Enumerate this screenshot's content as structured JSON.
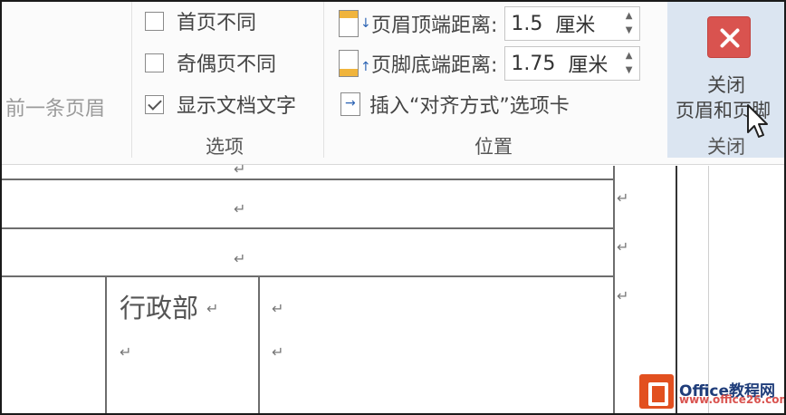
{
  "ribbon": {
    "navigation": {
      "prev_header_label": "前一条页眉"
    },
    "options": {
      "group_label": "选项",
      "items": [
        {
          "label": "首页不同",
          "checked": false
        },
        {
          "label": "奇偶页不同",
          "checked": false
        },
        {
          "label": "显示文档文字",
          "checked": true
        }
      ]
    },
    "position": {
      "group_label": "位置",
      "header_distance": {
        "label": "页眉顶端距离:",
        "value": "1.5",
        "unit": "厘米"
      },
      "footer_distance": {
        "label": "页脚底端距离:",
        "value": "1.75",
        "unit": "厘米"
      },
      "insert_align_tab_label": "插入“对齐方式”选项卡"
    },
    "close": {
      "group_label": "关闭",
      "button_line1": "关闭",
      "button_line2": "页眉和页脚"
    }
  },
  "document": {
    "paragraph_mark": "↵",
    "cell_text": "行政部"
  },
  "watermark": {
    "brand": "Office教程网",
    "url": "www.office26.com"
  },
  "colors": {
    "close_red": "#d9534f",
    "header_band": "#f0b43c",
    "close_group_bg": "#dbe5f1",
    "logo_orange": "#e2501f"
  }
}
